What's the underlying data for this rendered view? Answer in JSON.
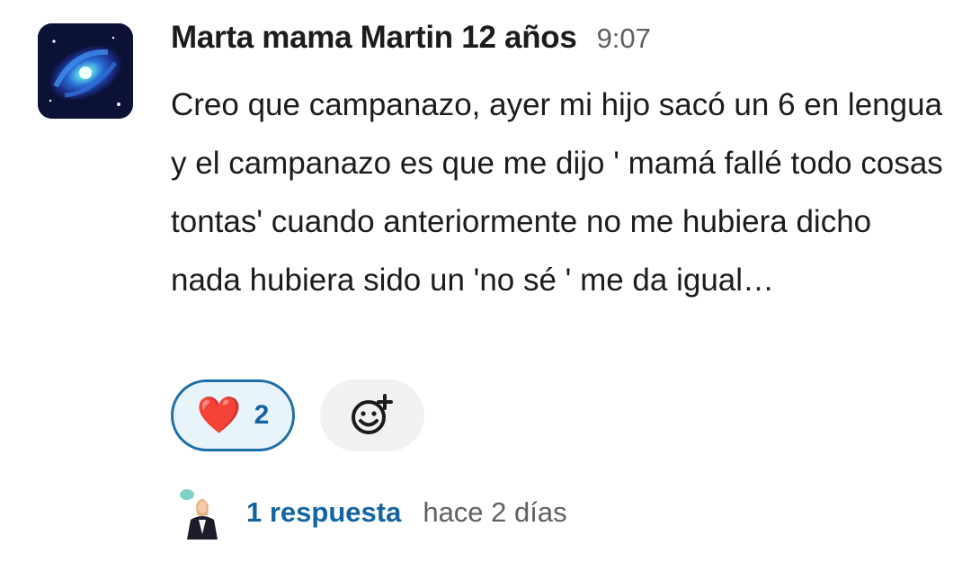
{
  "message": {
    "author": "Marta mama Martin 12 años",
    "time": "9:07",
    "text": "Creo que campanazo, ayer mi hijo sacó un 6 en lengua y el campanazo es que me dijo ' mamá fallé todo cosas tontas' cuando anteriormente no me hubiera dicho nada hubiera sido un 'no sé ' me da igual…"
  },
  "reactions": [
    {
      "emoji": "❤️",
      "icon": "heart-icon",
      "count": "2"
    }
  ],
  "add_reaction": {
    "icon": "add-emoji-icon"
  },
  "thread": {
    "replies_label": "1 respuesta",
    "last_reply": "hace 2 días"
  },
  "colors": {
    "link": "#1264a3",
    "reaction_border": "#1d6fa8",
    "reaction_bg": "#e8f4fa",
    "muted": "#616061"
  }
}
